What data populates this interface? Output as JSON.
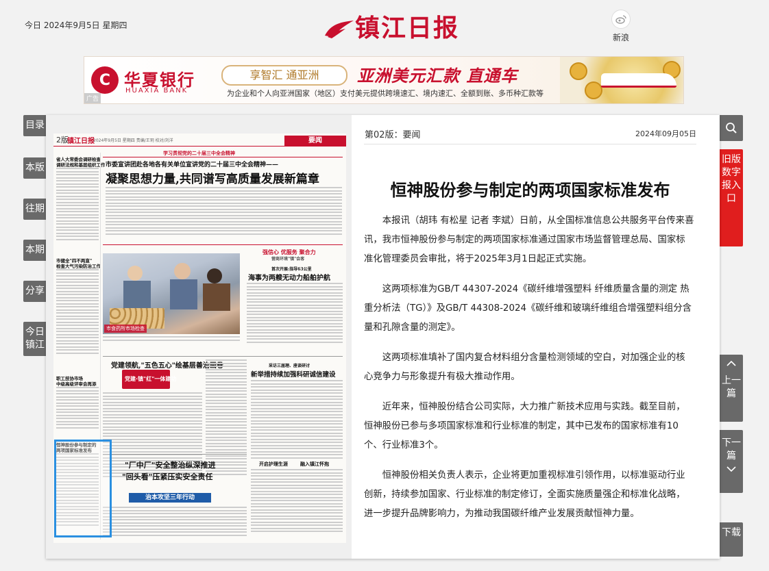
{
  "header": {
    "date_text": "今日 2024年9月5日 星期四",
    "masthead": "镇江日报",
    "weibo_label": "新浪"
  },
  "ad": {
    "bank_name_cn": "华夏银行",
    "bank_name_en": "HUAXIA BANK",
    "pill_text": "享智汇  通亚洲",
    "slogan": "亚洲美元汇款 直通车",
    "subline": "为企业和个人向亚洲国家（地区）支付美元提供跨境速汇、境内速汇、全额到账、多币种汇款等",
    "tag": "广告"
  },
  "left_nav": [
    {
      "label": "目录"
    },
    {
      "label": "本版"
    },
    {
      "label": "往期"
    },
    {
      "label": "本期"
    },
    {
      "label": "分享"
    },
    {
      "label": "今日镇江"
    }
  ],
  "right_nav": {
    "search": "search",
    "old_entry": "旧版数字报入口",
    "prev": "上一篇",
    "next": "下一篇",
    "download": "下载"
  },
  "newspaper": {
    "page_num": "2版",
    "paper_logo": "镇江日报",
    "page_date_line": "2024年9月5日 星期四   责编/王玥  校对/刘洋",
    "section": "要闻",
    "banner_small": "学习贯彻党的二十届三中全会精神",
    "lead_kicker": "市委宣讲团赴各地各有关单位宣讲党的二十届三中全会精神——",
    "lead_headline": "凝聚思想力量,共同谱写高质量发展新篇章",
    "left_col_head1": "省人大常委会调研检查",
    "left_col_head1b": "调研法规和基层组织工作",
    "left_col_head2": "市健全\"四不两直\"",
    "left_col_head2b": "检查大气污染防治工作",
    "left_col_head3": "职工技协市场",
    "left_col_head3b": "中级高级评审会再添",
    "left_col_head4": "恒神股份参与制定的",
    "left_col_head4b": "两项国家标准发布",
    "photo_caption": "市食药所市场检查",
    "box_title": "强信心 优服务 聚合力",
    "box_sub": "营商环境\"镇\"会客",
    "mid_kicker": "首次开展:指导63公里",
    "mid_headline": "海事为两艘无动力船舶护航",
    "party_headline": "党建领航,\"五色五心\"绘基层善治画卷",
    "party_logo": "党建·镇\"红\"一体建功",
    "right_kicker": "采访三届理、座谈研讨",
    "right_headline": "新举措持续加强科研诚信建设",
    "bottom_headline1": "\"厂中厂\"安全整治纵深推进",
    "bottom_headline2": "\"回头看\"压紧压实安全责任",
    "bottom_band": "治本攻坚三年行动",
    "bottom_right_1": "开启护理生涯",
    "bottom_right_2": "融入镇江怀抱"
  },
  "article": {
    "section_label": "第02版：要闻",
    "date": "2024年09月05日",
    "title": "恒神股份参与制定的两项国家标准发布",
    "paragraphs": [
      "本报讯（胡玮 有松星 记者 李斌）日前，从全国标准信息公共服务平台传来喜讯，我市恒神股份参与制定的两项国家标准通过国家市场监督管理总局、国家标准化管理委员会审批，将于2025年3月1日起正式实施。",
      "这两项标准为GB/T 44307-2024《碳纤维增强塑料 纤维质量含量的测定 热重分析法（TG）》及GB/T 44308-2024《碳纤维和玻璃纤维组合增强塑料组分含量和孔隙含量的测定》。",
      "这两项标准填补了国内复合材料组分含量检测领域的空白，对加强企业的核心竞争力与形象提升有极大推动作用。",
      "近年来，恒神股份结合公司实际，大力推广新技术应用与实践。截至目前，恒神股份已参与多项国家标准和行业标准的制定，其中已发布的国家标准有10个、行业标准3个。",
      "恒神股份相关负责人表示，企业将更加重视标准引领作用，以标准驱动行业创新，持续参加国家、行业标准的制定修订，全面实施质量强企和标准化战略，进一步提升品牌影响力，为推动我国碳纤维产业发展贡献恒神力量。"
    ]
  },
  "colors": {
    "brand_red": "#c8102e",
    "nav_gray": "#696969",
    "select_blue": "#2a8fe0"
  }
}
